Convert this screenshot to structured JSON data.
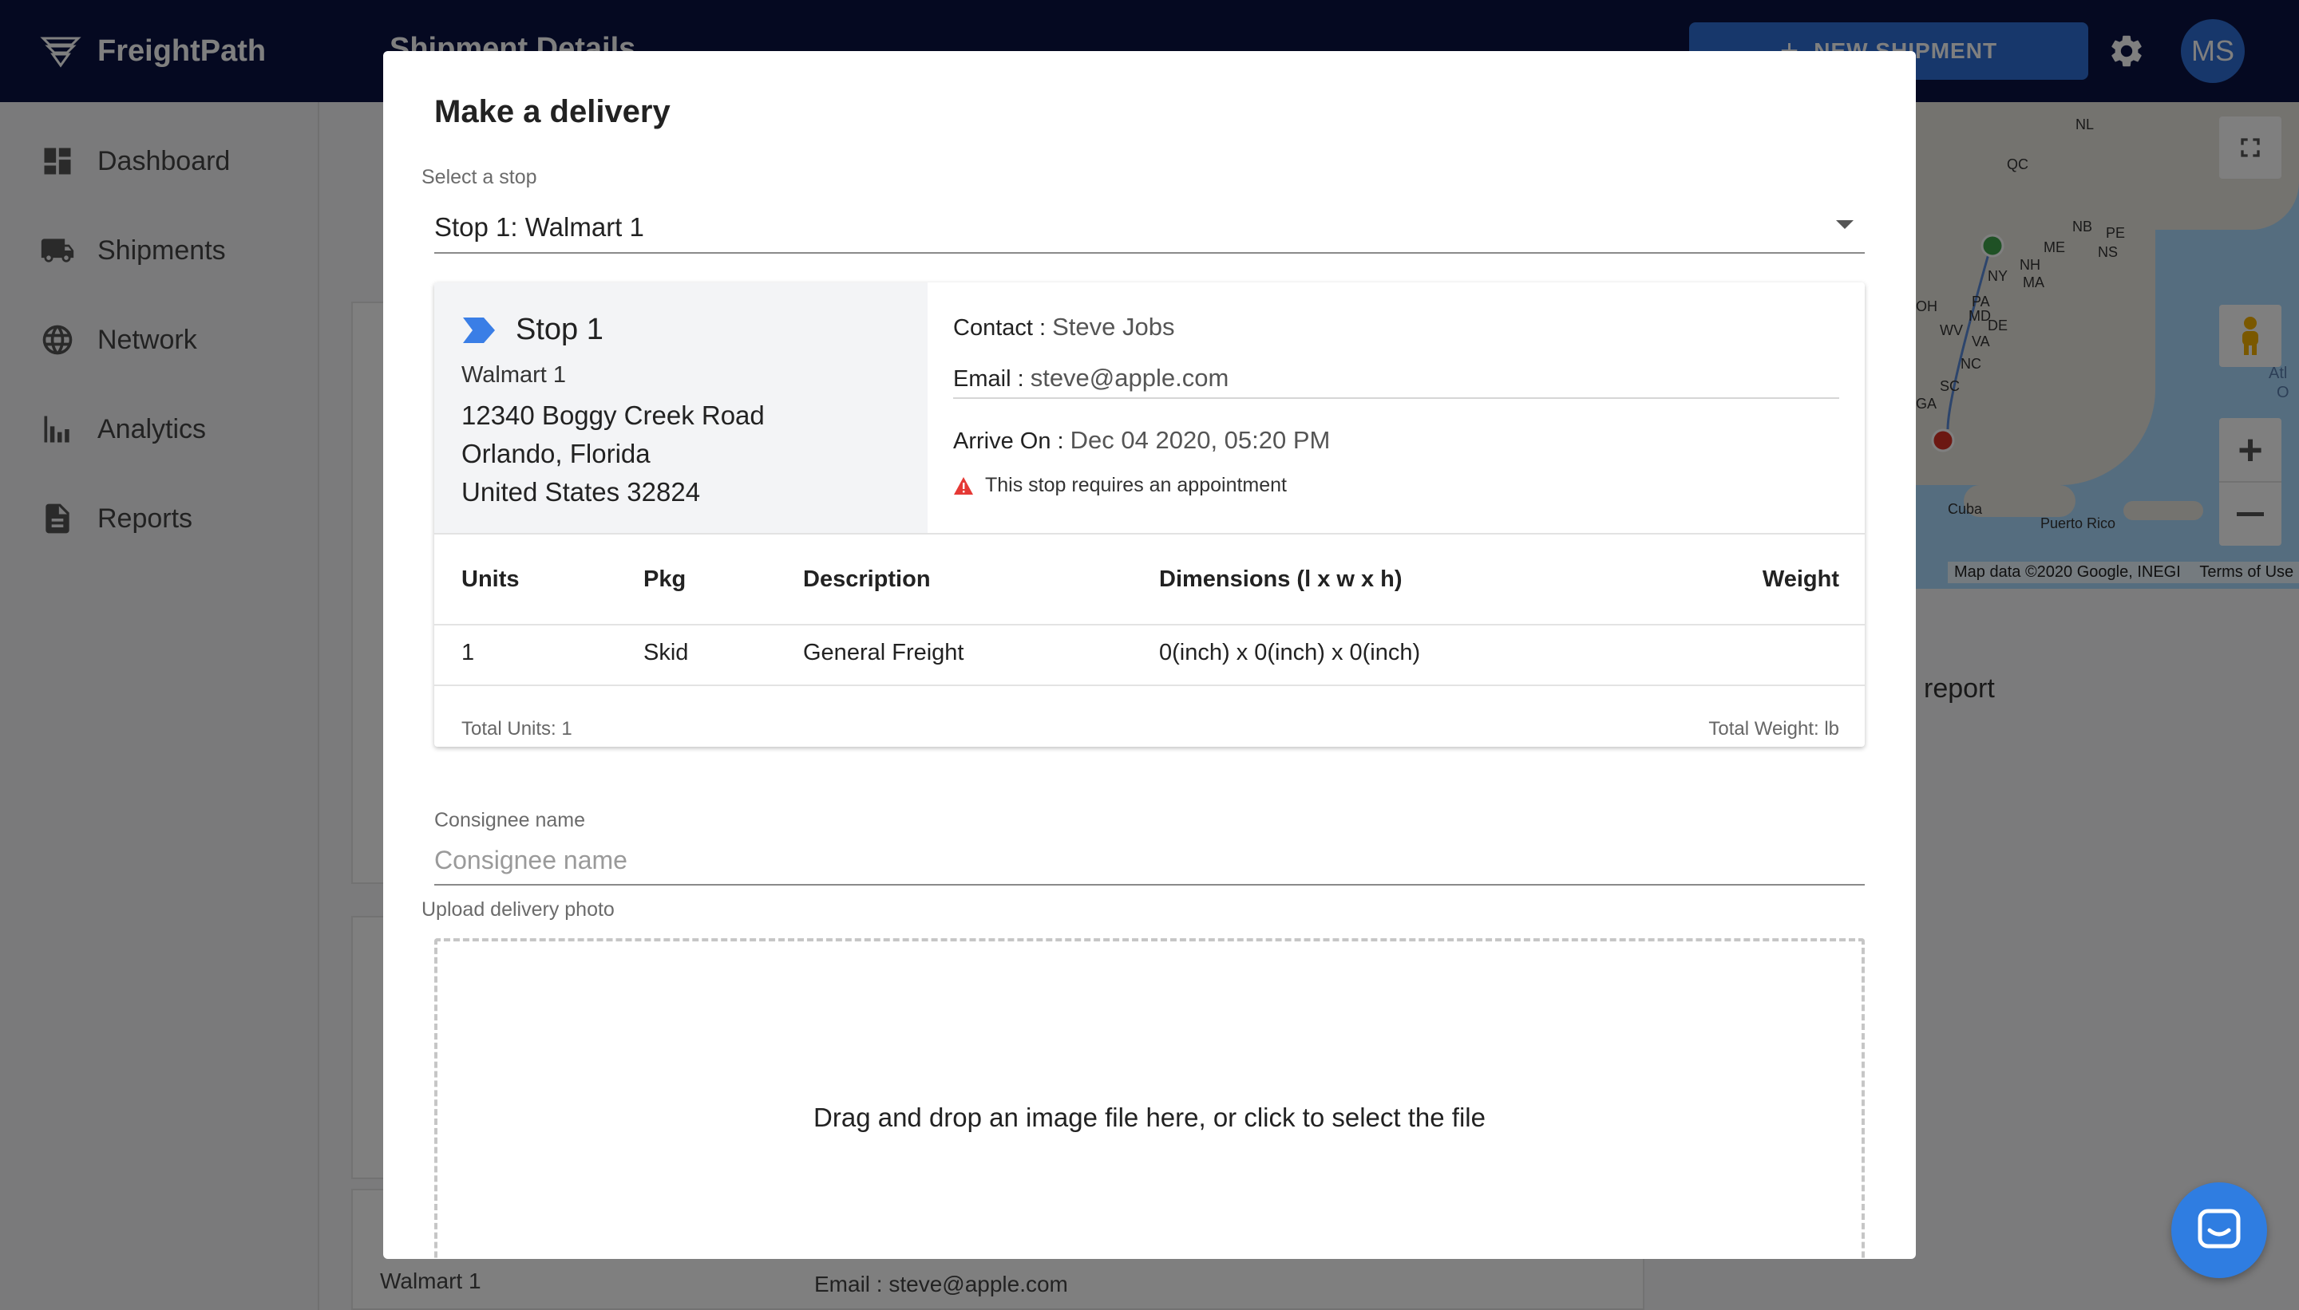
{
  "app": {
    "name": "FreightPath",
    "page_title": "Shipment Details",
    "new_shipment_label": "NEW SHIPMENT",
    "avatar_initials": "MS"
  },
  "sidebar": {
    "items": [
      {
        "label": "Dashboard",
        "icon": "dashboard-icon"
      },
      {
        "label": "Shipments",
        "icon": "truck-icon"
      },
      {
        "label": "Network",
        "icon": "globe-icon"
      },
      {
        "label": "Analytics",
        "icon": "bar-chart-icon"
      },
      {
        "label": "Reports",
        "icon": "document-icon"
      }
    ]
  },
  "background": {
    "report_link": "report",
    "stop_name_partial": "Walmart 1",
    "email_partial": "Email : steve@apple.com"
  },
  "map": {
    "labels": [
      "NL",
      "QC",
      "NB",
      "PE",
      "ME",
      "NS",
      "NH",
      "NY",
      "MA",
      "PA",
      "OH",
      "MD",
      "DE",
      "WV",
      "VA",
      "NC",
      "SC",
      "GA",
      "Cuba",
      "Puerto Rico",
      "Atl",
      "O"
    ],
    "footer_data": "Map data ©2020 Google, INEGI",
    "footer_terms": "Terms of Use"
  },
  "modal": {
    "title": "Make a delivery",
    "select_label": "Select a stop",
    "selected_stop": "Stop 1: Walmart 1",
    "stop": {
      "heading": "Stop 1",
      "name": "Walmart 1",
      "address_line1": "12340 Boggy Creek Road",
      "address_line2": "Orlando, Florida",
      "address_line3": "United States 32824",
      "contact_label": "Contact :",
      "contact_value": "Steve Jobs",
      "email_label": "Email :",
      "email_value": "steve@apple.com",
      "arrive_label": "Arrive On :",
      "arrive_value": "Dec 04 2020, 05:20 PM",
      "warning": "This stop requires an appointment"
    },
    "table": {
      "headers": [
        "Units",
        "Pkg",
        "Description",
        "Dimensions (l x w x h)",
        "Weight"
      ],
      "rows": [
        [
          "1",
          "Skid",
          "General Freight",
          "0(inch) x 0(inch) x 0(inch)",
          ""
        ]
      ],
      "total_units": "Total Units: 1",
      "total_weight": "Total Weight: lb"
    },
    "consignee": {
      "label": "Consignee name",
      "placeholder": "Consignee name",
      "value": ""
    },
    "upload": {
      "label": "Upload delivery photo",
      "dropzone_text": "Drag and drop an image file here, or click to select the file"
    }
  },
  "colors": {
    "topbar": "#0b1342",
    "accent": "#2f6fd6",
    "warning": "#e53935",
    "chat": "#2f7de1"
  }
}
